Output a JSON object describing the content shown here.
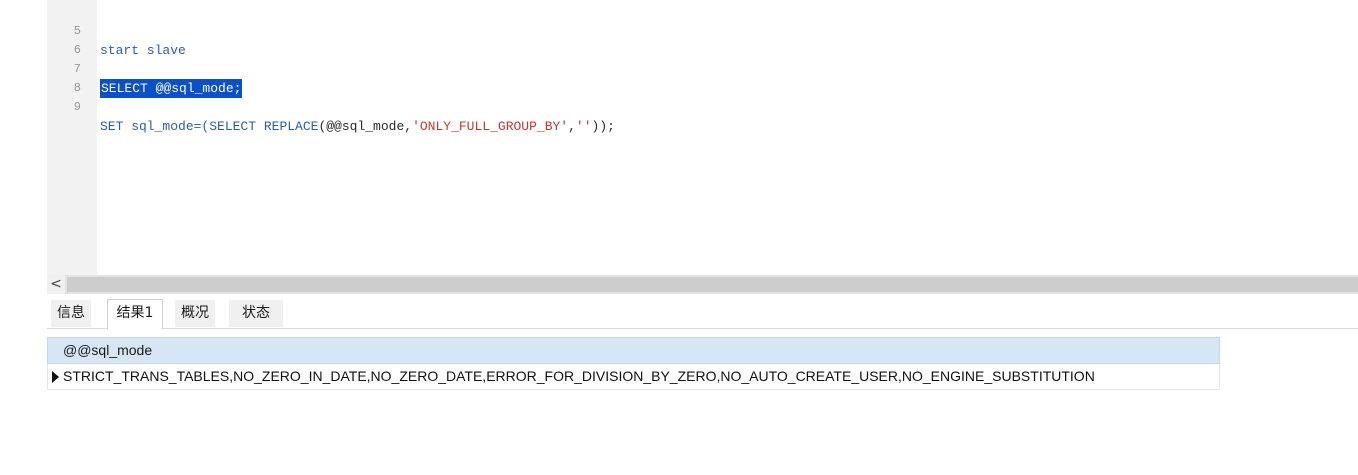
{
  "editor": {
    "lines": [
      {
        "num": "5",
        "text": "start slave"
      },
      {
        "num": "6",
        "text": ""
      },
      {
        "num": "7",
        "text": "SELECT @@sql_mode;"
      },
      {
        "num": "8",
        "text": ""
      },
      {
        "num": "9",
        "parts": [
          "SET sql_mode=(",
          "SELECT",
          " ",
          "REPLACE",
          "(@@sql_mode,",
          "'ONLY_FULL_GROUP_BY'",
          ",",
          "''",
          "));"
        ]
      }
    ]
  },
  "scrollbar": {
    "left_arrow": "<"
  },
  "tabs": [
    {
      "label": "信息",
      "active": false
    },
    {
      "label": "结果1",
      "active": true
    },
    {
      "label": "概况",
      "active": false
    },
    {
      "label": "状态",
      "active": false
    }
  ],
  "result": {
    "columns": [
      "@@sql_mode"
    ],
    "rows": [
      [
        "STRICT_TRANS_TABLES,NO_ZERO_IN_DATE,NO_ZERO_DATE,ERROR_FOR_DIVISION_BY_ZERO,NO_AUTO_CREATE_USER,NO_ENGINE_SUBSTITUTION"
      ]
    ]
  },
  "colors": {
    "keyword": "#2a5db0",
    "string": "#c0392b",
    "selection": "#0a50c8",
    "header": "#d6e6f5"
  }
}
